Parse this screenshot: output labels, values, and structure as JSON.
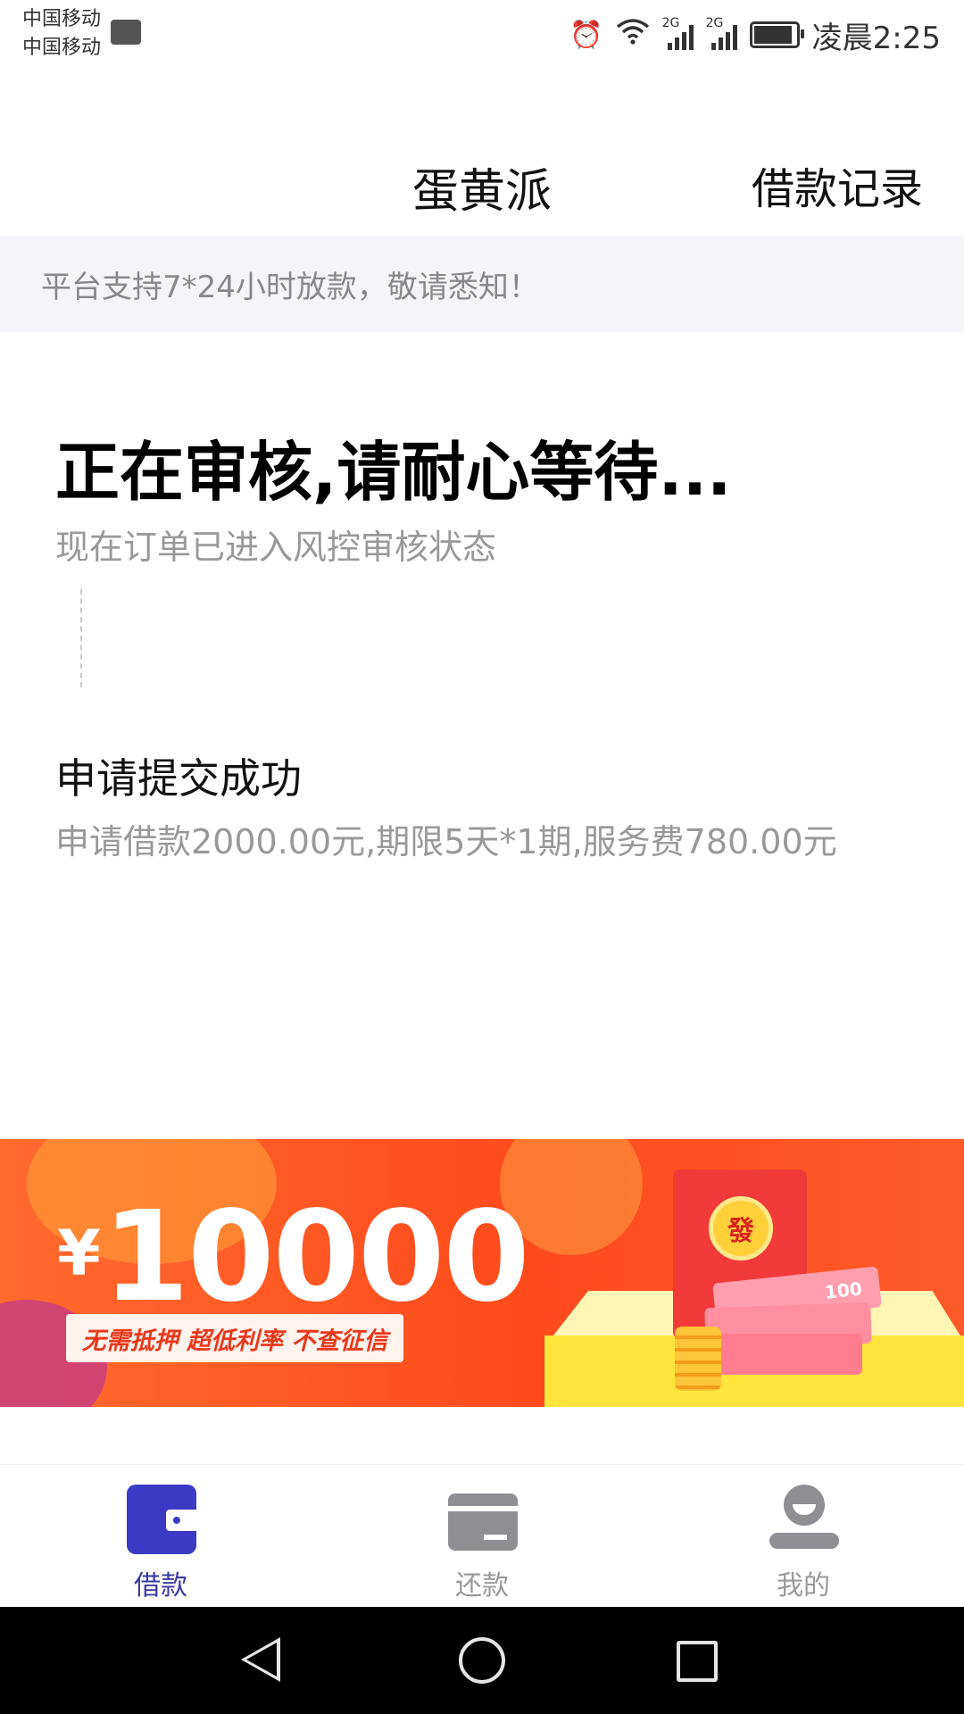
{
  "status_bar": {
    "carrier_1": "中国移动",
    "carrier_2": "中国移动",
    "network_1": "2G",
    "network_2": "2G",
    "time": "凌晨2:25"
  },
  "header": {
    "title": "蛋黄派",
    "record_link": "借款记录"
  },
  "notice": {
    "text": "平台支持7*24小时放款，敬请悉知！"
  },
  "review": {
    "title": "正在审核,请耐心等待...",
    "subtitle": "现在订单已进入风控审核状态"
  },
  "step": {
    "title": "申请提交成功",
    "description": "申请借款2000.00元,期限5天*1期,服务费780.00元"
  },
  "banner": {
    "currency": "¥",
    "amount": "10000",
    "tags": "无需抵押  超低利率  不查征信",
    "seal": "發",
    "bill": "100"
  },
  "tabs": [
    {
      "label": "借款",
      "icon": "wallet-icon",
      "active": true
    },
    {
      "label": "还款",
      "icon": "card-icon",
      "active": false
    },
    {
      "label": "我的",
      "icon": "user-icon",
      "active": false
    }
  ],
  "colors": {
    "accent": "#3a3ac4",
    "banner": "#ff4a1c",
    "muted": "#999999"
  }
}
